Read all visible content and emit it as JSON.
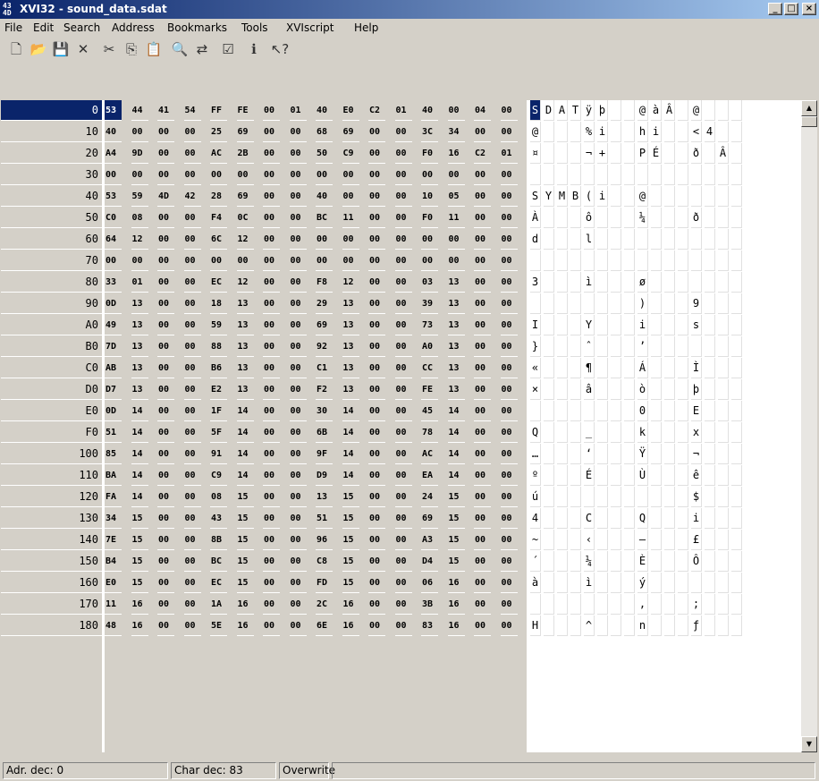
{
  "window": {
    "app_icon_text": "43\n4D",
    "title": "XVI32 - sound_data.sdat",
    "minimize": "_",
    "maximize": "□",
    "close": "×"
  },
  "menu": [
    "File",
    "Edit",
    "Search",
    "Address",
    "Bookmarks",
    "Tools",
    "XVIscript",
    "Help"
  ],
  "toolbar": [
    {
      "name": "new-file-icon",
      "glyph": "🗋"
    },
    {
      "name": "open-folder-icon",
      "glyph": "📂"
    },
    {
      "name": "save-icon",
      "glyph": "💾"
    },
    {
      "name": "delete-icon",
      "glyph": "✕"
    },
    {
      "name": "cut-icon",
      "glyph": "✂"
    },
    {
      "name": "copy-icon",
      "glyph": "⎘"
    },
    {
      "name": "paste-icon",
      "glyph": "📋"
    },
    {
      "name": "find-icon",
      "glyph": "🔍"
    },
    {
      "name": "replace-icon",
      "glyph": "⇄"
    },
    {
      "name": "properties-icon",
      "glyph": "☑"
    },
    {
      "name": "about-icon",
      "glyph": "ℹ"
    },
    {
      "name": "context-help-icon",
      "glyph": "↖?"
    }
  ],
  "rows": [
    {
      "addr": "0",
      "hex": [
        "53",
        "44",
        "41",
        "54",
        "FF",
        "FE",
        "00",
        "01",
        "40",
        "E0",
        "C2",
        "01",
        "40",
        "00",
        "04",
        "00"
      ],
      "chars": [
        "S",
        "D",
        "A",
        "T",
        "ÿ",
        "þ",
        "",
        "",
        "@",
        "à",
        "Â",
        "",
        "@",
        "",
        "",
        ""
      ]
    },
    {
      "addr": "10",
      "hex": [
        "40",
        "00",
        "00",
        "00",
        "25",
        "69",
        "00",
        "00",
        "68",
        "69",
        "00",
        "00",
        "3C",
        "34",
        "00",
        "00"
      ],
      "chars": [
        "@",
        "",
        "",
        "",
        "%",
        "i",
        "",
        "",
        "h",
        "i",
        "",
        "",
        "<",
        "4",
        "",
        ""
      ]
    },
    {
      "addr": "20",
      "hex": [
        "A4",
        "9D",
        "00",
        "00",
        "AC",
        "2B",
        "00",
        "00",
        "50",
        "C9",
        "00",
        "00",
        "F0",
        "16",
        "C2",
        "01"
      ],
      "chars": [
        "¤",
        "",
        "",
        "",
        "¬",
        "+",
        "",
        "",
        "P",
        "É",
        "",
        "",
        "ð",
        "",
        "Â",
        ""
      ]
    },
    {
      "addr": "30",
      "hex": [
        "00",
        "00",
        "00",
        "00",
        "00",
        "00",
        "00",
        "00",
        "00",
        "00",
        "00",
        "00",
        "00",
        "00",
        "00",
        "00"
      ],
      "chars": [
        "",
        "",
        "",
        "",
        "",
        "",
        "",
        "",
        "",
        "",
        "",
        "",
        "",
        "",
        "",
        ""
      ]
    },
    {
      "addr": "40",
      "hex": [
        "53",
        "59",
        "4D",
        "42",
        "28",
        "69",
        "00",
        "00",
        "40",
        "00",
        "00",
        "00",
        "10",
        "05",
        "00",
        "00"
      ],
      "chars": [
        "S",
        "Y",
        "M",
        "B",
        "(",
        "i",
        "",
        "",
        "@",
        "",
        "",
        "",
        "",
        "",
        "",
        ""
      ]
    },
    {
      "addr": "50",
      "hex": [
        "C0",
        "08",
        "00",
        "00",
        "F4",
        "0C",
        "00",
        "00",
        "BC",
        "11",
        "00",
        "00",
        "F0",
        "11",
        "00",
        "00"
      ],
      "chars": [
        "À",
        "",
        "",
        "",
        "ô",
        "",
        "",
        "",
        "¼",
        "",
        "",
        "",
        "ð",
        "",
        "",
        ""
      ]
    },
    {
      "addr": "60",
      "hex": [
        "64",
        "12",
        "00",
        "00",
        "6C",
        "12",
        "00",
        "00",
        "00",
        "00",
        "00",
        "00",
        "00",
        "00",
        "00",
        "00"
      ],
      "chars": [
        "d",
        "",
        "",
        "",
        "l",
        "",
        "",
        "",
        "",
        "",
        "",
        "",
        "",
        "",
        "",
        ""
      ]
    },
    {
      "addr": "70",
      "hex": [
        "00",
        "00",
        "00",
        "00",
        "00",
        "00",
        "00",
        "00",
        "00",
        "00",
        "00",
        "00",
        "00",
        "00",
        "00",
        "00"
      ],
      "chars": [
        "",
        "",
        "",
        "",
        "",
        "",
        "",
        "",
        "",
        "",
        "",
        "",
        "",
        "",
        "",
        ""
      ]
    },
    {
      "addr": "80",
      "hex": [
        "33",
        "01",
        "00",
        "00",
        "EC",
        "12",
        "00",
        "00",
        "F8",
        "12",
        "00",
        "00",
        "03",
        "13",
        "00",
        "00"
      ],
      "chars": [
        "3",
        "",
        "",
        "",
        "ì",
        "",
        "",
        "",
        "ø",
        "",
        "",
        "",
        "",
        "",
        "",
        ""
      ]
    },
    {
      "addr": "90",
      "hex": [
        "0D",
        "13",
        "00",
        "00",
        "18",
        "13",
        "00",
        "00",
        "29",
        "13",
        "00",
        "00",
        "39",
        "13",
        "00",
        "00"
      ],
      "chars": [
        "",
        "",
        "",
        "",
        "",
        "",
        "",
        "",
        ")",
        "",
        "",
        "",
        "9",
        "",
        "",
        ""
      ]
    },
    {
      "addr": "A0",
      "hex": [
        "49",
        "13",
        "00",
        "00",
        "59",
        "13",
        "00",
        "00",
        "69",
        "13",
        "00",
        "00",
        "73",
        "13",
        "00",
        "00"
      ],
      "chars": [
        "I",
        "",
        "",
        "",
        "Y",
        "",
        "",
        "",
        "i",
        "",
        "",
        "",
        "s",
        "",
        "",
        ""
      ]
    },
    {
      "addr": "B0",
      "hex": [
        "7D",
        "13",
        "00",
        "00",
        "88",
        "13",
        "00",
        "00",
        "92",
        "13",
        "00",
        "00",
        "A0",
        "13",
        "00",
        "00"
      ],
      "chars": [
        "}",
        "",
        "",
        "",
        "ˆ",
        "",
        "",
        "",
        "’",
        "",
        "",
        "",
        " ",
        "",
        "",
        ""
      ]
    },
    {
      "addr": "C0",
      "hex": [
        "AB",
        "13",
        "00",
        "00",
        "B6",
        "13",
        "00",
        "00",
        "C1",
        "13",
        "00",
        "00",
        "CC",
        "13",
        "00",
        "00"
      ],
      "chars": [
        "«",
        "",
        "",
        "",
        "¶",
        "",
        "",
        "",
        "Á",
        "",
        "",
        "",
        "Ì",
        "",
        "",
        ""
      ]
    },
    {
      "addr": "D0",
      "hex": [
        "D7",
        "13",
        "00",
        "00",
        "E2",
        "13",
        "00",
        "00",
        "F2",
        "13",
        "00",
        "00",
        "FE",
        "13",
        "00",
        "00"
      ],
      "chars": [
        "×",
        "",
        "",
        "",
        "â",
        "",
        "",
        "",
        "ò",
        "",
        "",
        "",
        "þ",
        "",
        "",
        ""
      ]
    },
    {
      "addr": "E0",
      "hex": [
        "0D",
        "14",
        "00",
        "00",
        "1F",
        "14",
        "00",
        "00",
        "30",
        "14",
        "00",
        "00",
        "45",
        "14",
        "00",
        "00"
      ],
      "chars": [
        "",
        "",
        "",
        "",
        "",
        "",
        "",
        "",
        "0",
        "",
        "",
        "",
        "E",
        "",
        "",
        ""
      ]
    },
    {
      "addr": "F0",
      "hex": [
        "51",
        "14",
        "00",
        "00",
        "5F",
        "14",
        "00",
        "00",
        "6B",
        "14",
        "00",
        "00",
        "78",
        "14",
        "00",
        "00"
      ],
      "chars": [
        "Q",
        "",
        "",
        "",
        "_",
        "",
        "",
        "",
        "k",
        "",
        "",
        "",
        "x",
        "",
        "",
        ""
      ]
    },
    {
      "addr": "100",
      "hex": [
        "85",
        "14",
        "00",
        "00",
        "91",
        "14",
        "00",
        "00",
        "9F",
        "14",
        "00",
        "00",
        "AC",
        "14",
        "00",
        "00"
      ],
      "chars": [
        "…",
        "",
        "",
        "",
        "‘",
        "",
        "",
        "",
        "Ÿ",
        "",
        "",
        "",
        "¬",
        "",
        "",
        ""
      ]
    },
    {
      "addr": "110",
      "hex": [
        "BA",
        "14",
        "00",
        "00",
        "C9",
        "14",
        "00",
        "00",
        "D9",
        "14",
        "00",
        "00",
        "EA",
        "14",
        "00",
        "00"
      ],
      "chars": [
        "º",
        "",
        "",
        "",
        "É",
        "",
        "",
        "",
        "Ù",
        "",
        "",
        "",
        "ê",
        "",
        "",
        ""
      ]
    },
    {
      "addr": "120",
      "hex": [
        "FA",
        "14",
        "00",
        "00",
        "08",
        "15",
        "00",
        "00",
        "13",
        "15",
        "00",
        "00",
        "24",
        "15",
        "00",
        "00"
      ],
      "chars": [
        "ú",
        "",
        "",
        "",
        "",
        "",
        "",
        "",
        "",
        "",
        "",
        "",
        "$",
        "",
        "",
        ""
      ]
    },
    {
      "addr": "130",
      "hex": [
        "34",
        "15",
        "00",
        "00",
        "43",
        "15",
        "00",
        "00",
        "51",
        "15",
        "00",
        "00",
        "69",
        "15",
        "00",
        "00"
      ],
      "chars": [
        "4",
        "",
        "",
        "",
        "C",
        "",
        "",
        "",
        "Q",
        "",
        "",
        "",
        "i",
        "",
        "",
        ""
      ]
    },
    {
      "addr": "140",
      "hex": [
        "7E",
        "15",
        "00",
        "00",
        "8B",
        "15",
        "00",
        "00",
        "96",
        "15",
        "00",
        "00",
        "A3",
        "15",
        "00",
        "00"
      ],
      "chars": [
        "~",
        "",
        "",
        "",
        "‹",
        "",
        "",
        "",
        "–",
        "",
        "",
        "",
        "£",
        "",
        "",
        ""
      ]
    },
    {
      "addr": "150",
      "hex": [
        "B4",
        "15",
        "00",
        "00",
        "BC",
        "15",
        "00",
        "00",
        "C8",
        "15",
        "00",
        "00",
        "D4",
        "15",
        "00",
        "00"
      ],
      "chars": [
        "´",
        "",
        "",
        "",
        "¼",
        "",
        "",
        "",
        "È",
        "",
        "",
        "",
        "Ô",
        "",
        "",
        ""
      ]
    },
    {
      "addr": "160",
      "hex": [
        "E0",
        "15",
        "00",
        "00",
        "EC",
        "15",
        "00",
        "00",
        "FD",
        "15",
        "00",
        "00",
        "06",
        "16",
        "00",
        "00"
      ],
      "chars": [
        "à",
        "",
        "",
        "",
        "ì",
        "",
        "",
        "",
        "ý",
        "",
        "",
        "",
        "",
        "",
        "",
        ""
      ]
    },
    {
      "addr": "170",
      "hex": [
        "11",
        "16",
        "00",
        "00",
        "1A",
        "16",
        "00",
        "00",
        "2C",
        "16",
        "00",
        "00",
        "3B",
        "16",
        "00",
        "00"
      ],
      "chars": [
        "",
        "",
        "",
        "",
        "",
        "",
        "",
        "",
        ",",
        "",
        "",
        "",
        ";",
        "",
        "",
        ""
      ]
    },
    {
      "addr": "180",
      "hex": [
        "48",
        "16",
        "00",
        "00",
        "5E",
        "16",
        "00",
        "00",
        "6E",
        "16",
        "00",
        "00",
        "83",
        "16",
        "00",
        "00"
      ],
      "chars": [
        "H",
        "",
        "",
        "",
        "^",
        "",
        "",
        "",
        "n",
        "",
        "",
        "",
        "ƒ",
        "",
        "",
        ""
      ]
    }
  ],
  "selected_offset": 0,
  "status": {
    "addr": "Adr. dec: 0",
    "char": "Char dec: 83",
    "mode": "Overwrite"
  }
}
